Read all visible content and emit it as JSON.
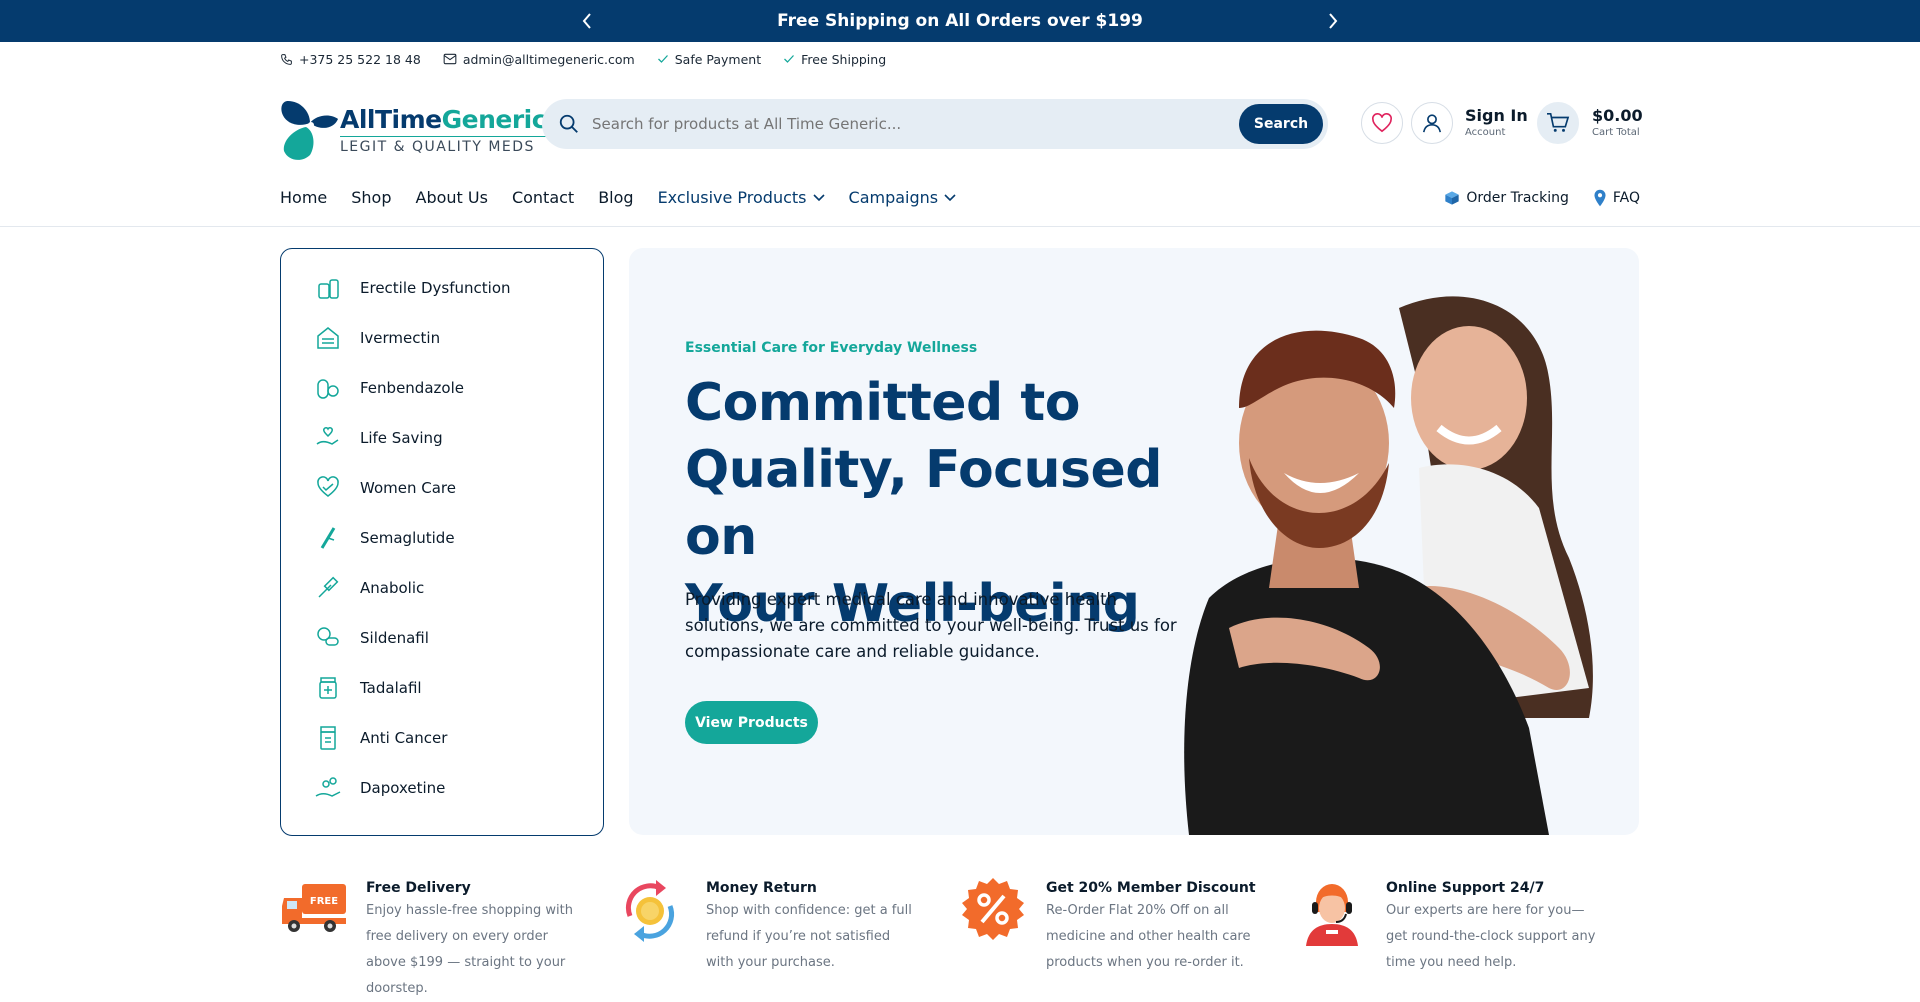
{
  "topbar": {
    "message": "Free Shipping on All Orders over $199"
  },
  "contact": {
    "phone": "+375 25 522 18 48",
    "email": "admin@alltimegeneric.com",
    "safe_payment": "Safe Payment",
    "free_shipping": "Free Shipping"
  },
  "logo": {
    "part1": "AllTime",
    "part2": "Generic",
    "tagline": "LEGIT & QUALITY MEDS"
  },
  "search": {
    "placeholder": "Search for products at All Time Generic...",
    "button": "Search"
  },
  "account": {
    "title": "Sign In",
    "subtitle": "Account"
  },
  "cart": {
    "total": "$0.00",
    "label": "Cart Total"
  },
  "nav": {
    "links": [
      "Home",
      "Shop",
      "About Us",
      "Contact",
      "Blog"
    ],
    "exclusive": "Exclusive Products",
    "campaigns": "Campaigns",
    "order_tracking": "Order Tracking",
    "faq": "FAQ"
  },
  "categories": [
    "Erectile Dysfunction",
    "Ivermectin",
    "Fenbendazole",
    "Life Saving",
    "Women Care",
    "Semaglutide",
    "Anabolic",
    "Sildenafil",
    "Tadalafil",
    "Anti Cancer",
    "Dapoxetine"
  ],
  "hero": {
    "kicker": "Essential Care for Everyday Wellness",
    "title_line1": "Committed to",
    "title_line2": "Quality, Focused on",
    "title_line3": "Your Well-being",
    "description": "Providing expert medical care and innovative health solutions, we are committed to your well-being. Trust us for compassionate care and reliable guidance.",
    "cta": "View Products"
  },
  "features": [
    {
      "title": "Free Delivery",
      "desc": "Enjoy hassle-free shopping with free delivery on every order above $199 — straight to your doorstep.",
      "badge": "FREE"
    },
    {
      "title": "Money Return",
      "desc": "Shop with confidence: get a full refund if you’re not satisfied with your purchase."
    },
    {
      "title": "Get 20% Member Discount",
      "desc": "Re-Order Flat 20% Off on all medicine and other health care products when you re-order it."
    },
    {
      "title": "Online Support 24/7",
      "desc": "Our experts are here for you—get round-the-clock support any time you need help."
    }
  ],
  "colors": {
    "brand_navy": "#053b6e",
    "brand_teal": "#14a79a",
    "hero_bg": "#f3f7fc"
  }
}
